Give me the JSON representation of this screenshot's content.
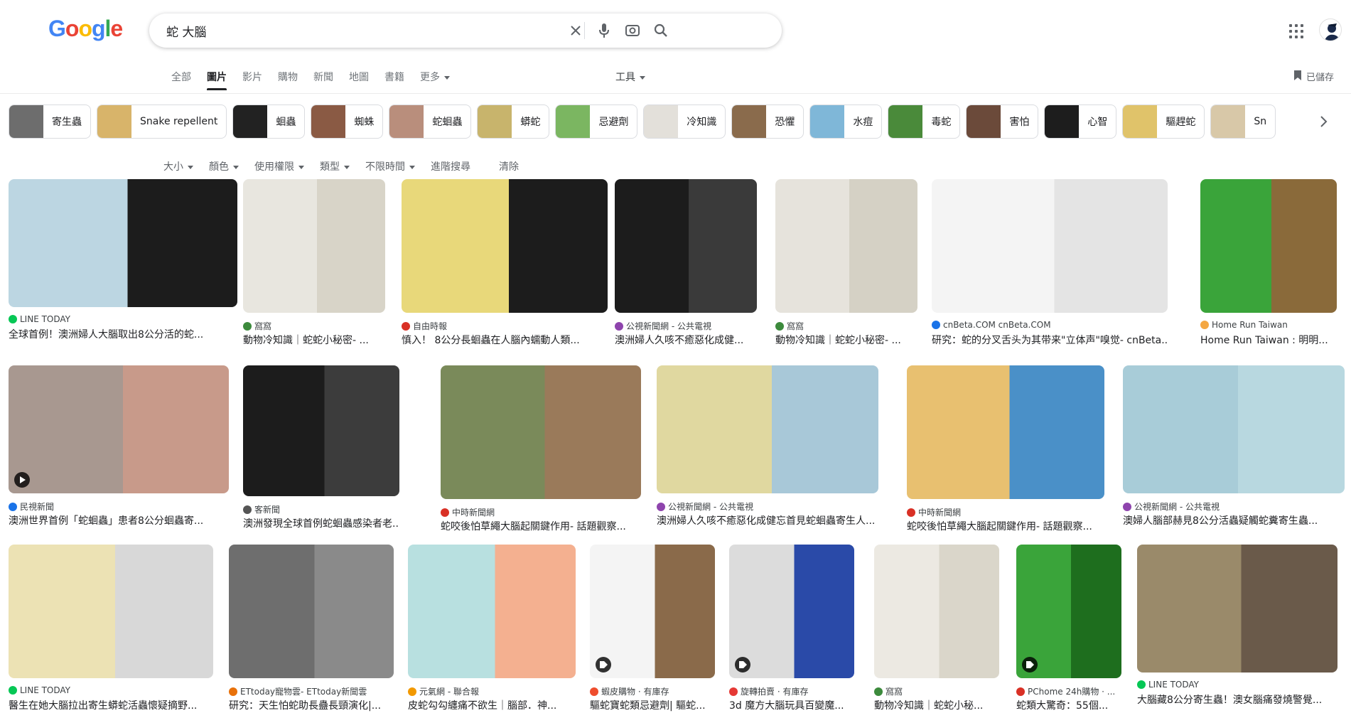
{
  "header": {
    "logo_letters": [
      "G",
      "o",
      "o",
      "g",
      "l",
      "e"
    ],
    "logo_colors": [
      "#4285f4",
      "#ea4335",
      "#fbbc05",
      "#4285f4",
      "#34a853",
      "#ea4335"
    ],
    "search_value": "蛇 大腦",
    "saved_label": "已儲存"
  },
  "tabs": [
    "全部",
    "圖片",
    "影片",
    "購物",
    "新聞",
    "地圖",
    "書籍",
    "更多"
  ],
  "active_tab": "圖片",
  "tools_label": "工具",
  "chips": [
    {
      "label": "寄生蟲",
      "color": "#6d6d6d"
    },
    {
      "label": "Snake repellent",
      "color": "#d8b46a"
    },
    {
      "label": "蛔蟲",
      "color": "#222222"
    },
    {
      "label": "蜘蛛",
      "color": "#8a5a44"
    },
    {
      "label": "蛇蛔蟲",
      "color": "#b98e7c"
    },
    {
      "label": "蟒蛇",
      "color": "#c8b46c"
    },
    {
      "label": "忌避劑",
      "color": "#7bb661"
    },
    {
      "label": "冷知識",
      "color": "#e3e0da"
    },
    {
      "label": "恐懼",
      "color": "#8a6b4c"
    },
    {
      "label": "水痘",
      "color": "#7fb7d8"
    },
    {
      "label": "毒蛇",
      "color": "#4a8a3a"
    },
    {
      "label": "害怕",
      "color": "#6b4a3a"
    },
    {
      "label": "心智",
      "color": "#1d1d1d"
    },
    {
      "label": "驅趕蛇",
      "color": "#e0c36a"
    },
    {
      "label": "Sn",
      "color": "#d8c8a8"
    }
  ],
  "filters": [
    "大小",
    "顏色",
    "使用權限",
    "類型",
    "不限時間",
    "進階搜尋",
    "清除"
  ],
  "results": [
    {
      "source": "LINE TODAY",
      "title": "全球首例！澳洲婦人大腦取出8公分活的蛇...",
      "fav": "#06c755",
      "c1": "#bcd6e2",
      "c2": "#1c1c1c",
      "badge": ""
    },
    {
      "source": "窩窩",
      "title": "動物冷知識｜蛇蛇小秘密- ...",
      "fav": "#3c8a3c",
      "c1": "#e8e6df",
      "c2": "#d8d4c8",
      "badge": ""
    },
    {
      "source": "自由時報",
      "title": "慎入！ 8公分長蛔蟲在人腦內蠕動人類...",
      "fav": "#d93025",
      "c1": "#e8d87a",
      "c2": "#1c1c1c",
      "badge": ""
    },
    {
      "source": "公視新聞網 - 公共電視",
      "title": "澳洲婦人久咳不癒惡化成健...",
      "fav": "#8e44ad",
      "c1": "#1c1c1c",
      "c2": "#3a3a3a",
      "badge": ""
    },
    {
      "source": "窩窩",
      "title": "動物冷知識｜蛇蛇小秘密- ...",
      "fav": "#3c8a3c",
      "c1": "#e6e3dc",
      "c2": "#d5d1c5",
      "badge": ""
    },
    {
      "source": "cnBeta.COM cnBeta.COM",
      "title": "研究：蛇的分叉舌头为其带来\"立体声\"嗅觉- cnBeta...",
      "fav": "#1a73e8",
      "c1": "#f4f4f4",
      "c2": "#e4e4e4",
      "badge": ""
    },
    {
      "source": "Home Run Taiwan",
      "title": "Home Run Taiwan : 明明...",
      "fav": "#f4a742",
      "c1": "#3aa43a",
      "c2": "#8a6a3a",
      "badge": ""
    },
    {
      "source": "民視新聞",
      "title": "澳洲世界首例「蛇蛔蟲」患者8公分蛔蟲寄...",
      "fav": "#1a73e8",
      "c1": "#a89890",
      "c2": "#c89a8a",
      "badge": "play"
    },
    {
      "source": "客新聞",
      "title": "澳洲發現全球首例蛇蛔蟲感染者老...",
      "fav": "#555555",
      "c1": "#1c1c1c",
      "c2": "#3c3c3c",
      "badge": ""
    },
    {
      "source": "中時新聞網",
      "title": "蛇咬後怕草繩大腦起關鍵作用- 話題觀察...",
      "fav": "#d93025",
      "c1": "#7a8a5a",
      "c2": "#9a7a5a",
      "badge": ""
    },
    {
      "source": "公視新聞網 - 公共電視",
      "title": "澳洲婦人久咳不癒惡化成健忘首見蛇蛔蟲寄生人...",
      "fav": "#8e44ad",
      "c1": "#e0d8a0",
      "c2": "#a8c8d8",
      "badge": ""
    },
    {
      "source": "中時新聞網",
      "title": "蛇咬後怕草繩大腦起關鍵作用- 話題觀察...",
      "fav": "#d93025",
      "c1": "#e8c070",
      "c2": "#4a90c8",
      "badge": ""
    },
    {
      "source": "公視新聞網 - 公共電視",
      "title": "澳婦人腦部赫見8公分活蟲疑觸蛇糞寄生蟲...",
      "fav": "#8e44ad",
      "c1": "#a8ccd8",
      "c2": "#b8d8e0",
      "badge": ""
    },
    {
      "source": "LINE TODAY",
      "title": "醫生在她大腦拉出寄生蟒蛇活蟲懷疑摘野...",
      "fav": "#06c755",
      "c1": "#ece2b4",
      "c2": "#d8d8d8",
      "badge": ""
    },
    {
      "source": "ETtoday寵物雲- ETtoday新聞雲",
      "title": "研究：天生怕蛇助長蠱長頸演化|...",
      "fav": "#e8710a",
      "c1": "#6e6e6e",
      "c2": "#8a8a8a",
      "badge": ""
    },
    {
      "source": "元氣網 - 聯合報",
      "title": "皮蛇勾勾纏痛不欲生｜腦部．神...",
      "fav": "#f29900",
      "c1": "#b8e0e0",
      "c2": "#f4b090",
      "badge": ""
    },
    {
      "source": "蝦皮購物 · 有庫存",
      "title": "驅蛇寶蛇類忌避劑| 驅蛇...",
      "fav": "#ee4d2d",
      "c1": "#f4f4f4",
      "c2": "#8a6a4a",
      "badge": "tag"
    },
    {
      "source": "旋轉拍賣 · 有庫存",
      "title": "3d 魔方大腦玩具百變魔...",
      "fav": "#e53935",
      "c1": "#dcdcdc",
      "c2": "#2a4aa8",
      "badge": "tag"
    },
    {
      "source": "窩窩",
      "title": "動物冷知識｜蛇蛇小秘...",
      "fav": "#3c8a3c",
      "c1": "#ece9e2",
      "c2": "#dad6ca",
      "badge": ""
    },
    {
      "source": "PChome 24h購物 · ...",
      "title": "蛇類大驚奇：55個...",
      "fav": "#d93025",
      "c1": "#3aa43a",
      "c2": "#1e6e1e",
      "badge": "tag"
    },
    {
      "source": "LINE TODAY",
      "title": "大腦藏8公分寄生蟲！澳女腦痛發燒警覺...",
      "fav": "#06c755",
      "c1": "#9a8a6a",
      "c2": "#6a5a4a",
      "badge": ""
    }
  ]
}
